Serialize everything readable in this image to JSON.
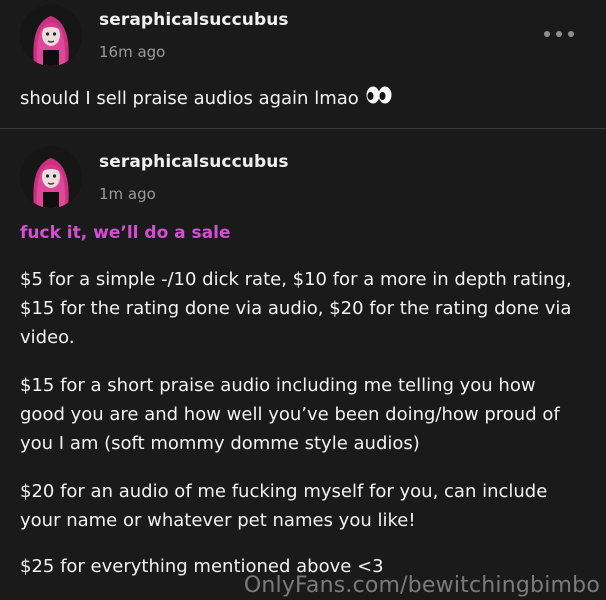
{
  "colors": {
    "background": "#1a1a1a",
    "text": "#f2f2f2",
    "muted": "#9a9a9a",
    "accent": "#d24fd2"
  },
  "posts": [
    {
      "username": "seraphicalsuccubus",
      "timestamp": "16m ago",
      "text": "should I sell praise audios again lmao",
      "emoji": "eyes-emoji",
      "menu_icon": "more-horizontal-icon"
    },
    {
      "username": "seraphicalsuccubus",
      "timestamp": "1m ago",
      "highlight": "fuck it, we’ll do a sale",
      "paragraphs": [
        "$5 for a simple -/10 dick rate, $10 for a more in depth rating, $15 for the rating done via audio, $20 for the rating done via video.",
        "$15 for a short praise audio including me telling you how good you are and how well you’ve been doing/how proud of you I am (soft mommy domme style audios)",
        "$20 for an audio of me fucking myself for you, can include your name or whatever pet names you like!",
        "$25 for everything mentioned above <3"
      ]
    }
  ],
  "watermark": "OnlyFans.com/bewitchingbimbo"
}
